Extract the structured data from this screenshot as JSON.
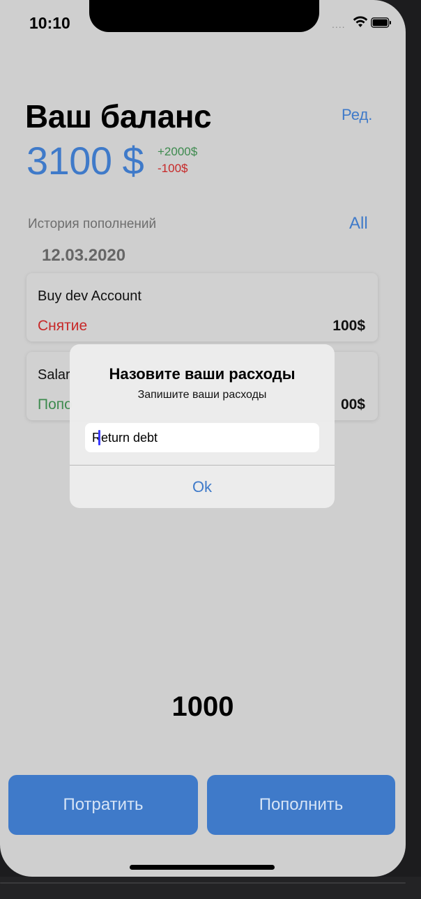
{
  "status_bar": {
    "time": "10:10",
    "signal": "....",
    "icons": [
      "wifi-icon",
      "battery-icon"
    ]
  },
  "header": {
    "title": "Ваш баланс",
    "edit_label": "Ред."
  },
  "balance": {
    "amount": "3100 $",
    "income": "+2000$",
    "expense": "-100$"
  },
  "history": {
    "label": "История пополнений",
    "all_label": "All",
    "date": "12.03.2020",
    "items": [
      {
        "title": "Buy dev Account",
        "type": "Снятие",
        "amount": "100$"
      },
      {
        "title": "Salar",
        "type": "Попо",
        "amount": "00$"
      }
    ]
  },
  "amount_display": "1000",
  "buttons": {
    "spend": "Потратить",
    "topup": "Пополнить"
  },
  "alert": {
    "title": "Назовите ваши расходы",
    "message": "Запишите ваши расходы",
    "input_value": "Return debt",
    "ok_label": "Ok"
  },
  "colors": {
    "accent": "#3f7ac9",
    "withdraw": "#c72828",
    "deposit": "#3d8a4e",
    "background": "#cfcfcf"
  }
}
